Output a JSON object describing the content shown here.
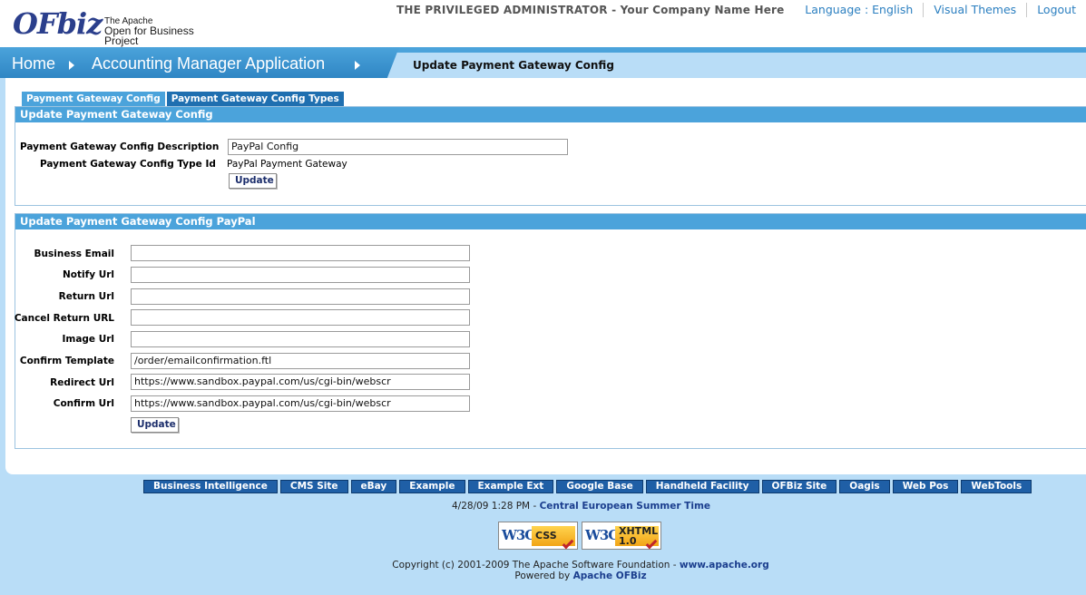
{
  "header": {
    "logo_text": "OFbiz",
    "logo_line1": "The Apache",
    "logo_line2": "Open for Business Project",
    "user_label": "THE PRIVILEGED ADMINISTRATOR",
    "company_label": "Your Company Name Here",
    "links": [
      "Language : English",
      "Visual Themes",
      "Logout"
    ]
  },
  "breadcrumb": {
    "home": "Home",
    "app": "Accounting Manager Application",
    "page_title": "Update Payment Gateway Config"
  },
  "tabs": [
    "Payment Gateway Config",
    "Payment Gateway Config Types"
  ],
  "config_box": {
    "title": "Update Payment Gateway Config",
    "description_label": "Payment Gateway Config Description",
    "description_value": "PayPal Config",
    "type_label": "Payment Gateway Config Type Id",
    "type_value": "PayPal Payment Gateway",
    "update_label": "Update"
  },
  "paypal_box": {
    "title": "Update Payment Gateway Config PayPal",
    "fields": [
      {
        "label": "Business Email",
        "value": ""
      },
      {
        "label": "Notify Url",
        "value": ""
      },
      {
        "label": "Return Url",
        "value": ""
      },
      {
        "label": "Cancel Return URL",
        "value": ""
      },
      {
        "label": "Image Url",
        "value": ""
      },
      {
        "label": "Confirm Template",
        "value": "/order/emailconfirmation.ftl"
      },
      {
        "label": "Redirect Url",
        "value": "https://www.sandbox.paypal.com/us/cgi-bin/webscr"
      },
      {
        "label": "Confirm Url",
        "value": "https://www.sandbox.paypal.com/us/cgi-bin/webscr"
      }
    ],
    "update_label": "Update"
  },
  "app_bar": [
    "Business Intelligence",
    "CMS Site",
    "eBay",
    "Example",
    "Example Ext",
    "Google Base",
    "Handheld Facility",
    "OFBiz Site",
    "Oagis",
    "Web Pos",
    "WebTools"
  ],
  "footer": {
    "datetime": "4/28/09 1:28 PM",
    "timezone": "Central European Summer Time",
    "badge_css": "CSS",
    "badge_xhtml_1": "XHTML",
    "badge_xhtml_2": "1.0",
    "badge_w3c": "W3C",
    "copyright": "Copyright (c) 2001-2009 The Apache Software Foundation -",
    "apache_link": "www.apache.org",
    "powered_by": "Powered by",
    "ofbiz_link": "Apache OFBiz"
  }
}
